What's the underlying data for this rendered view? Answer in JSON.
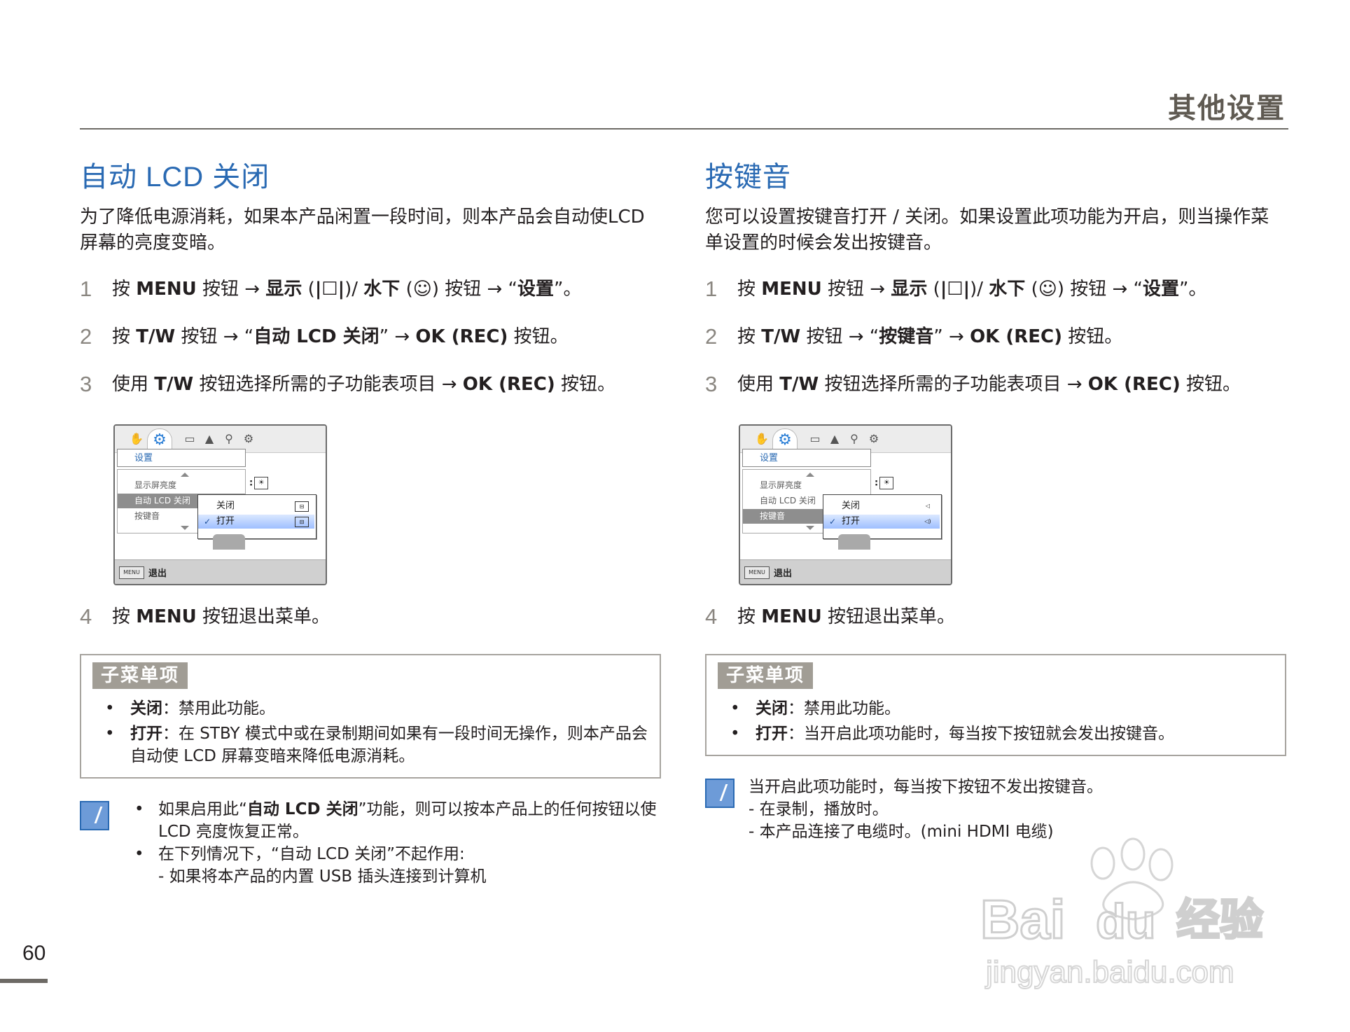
{
  "header": {
    "title": "其他设置"
  },
  "page_number": "60",
  "left": {
    "title": "自动 LCD 关闭",
    "intro": "为了降低电源消耗，如果本产品闲置一段时间，则本产品会自动使LCD 屏幕的亮度变暗。",
    "steps": [
      {
        "num": "1",
        "t1": "按 ",
        "b1": "MENU",
        "t2": " 按钮  → ",
        "b2": "显示",
        "t3": " (",
        "b3": "|☐|",
        "t4": ")/ ",
        "b4": "水下",
        "t5": " (☺) 按钮  → “",
        "b5": "设置",
        "t6": "”。"
      },
      {
        "num": "2",
        "t1": "按 ",
        "b1": "T/W",
        "t2": " 按钮  → “",
        "b2": "自动 LCD 关闭",
        "t3": "” → ",
        "b3": "OK (REC)",
        "t4": " 按钮。"
      },
      {
        "num": "3",
        "t1": "使用 ",
        "b1": "T/W",
        "t2": " 按钮选择所需的子功能表项目 → ",
        "b2": "OK (REC)",
        "t3": " 按钮。"
      },
      {
        "num": "4",
        "t1": "按 ",
        "b1": "MENU",
        "t2": " 按钮退出菜单。"
      }
    ],
    "menu": {
      "category": "设置",
      "items": [
        "显示屏亮度",
        "自动 LCD 关闭",
        "按键音"
      ],
      "highlight_index": 1,
      "current_value_prefix": ":",
      "current_value_icon": "☀",
      "options": [
        "关闭",
        "打开"
      ],
      "option_icons": [
        "⊟",
        "⊟"
      ],
      "selected_index": 1,
      "check_glyph": "✓",
      "menu_button": "MENU",
      "exit": "退出"
    },
    "submenu": {
      "tag": "子菜单项",
      "items": [
        {
          "key": "关闭",
          "sep": "：",
          "desc": "禁用此功能。"
        },
        {
          "key": "打开",
          "sep": "：",
          "desc": "在 STBY 模式中或在录制期间如果有一段时间无操作，则本产品会自动使 LCD 屏幕变暗来降低电源消耗。"
        }
      ]
    },
    "note": {
      "b1_t1": "如果启用此“",
      "b1_b": "自动 LCD 关闭",
      "b1_t2": "”功能，则可以按本产品上的任何按钮以使 LCD 亮度恢复正常。",
      "b2": "在下列情况下，“自动 LCD 关闭”不起作用:",
      "sub1": "- 如果将本产品的内置 USB 插头连接到计算机"
    }
  },
  "right": {
    "title": "按键音",
    "intro": "您可以设置按键音打开 / 关闭。如果设置此项功能为开启，则当操作菜单设置的时候会发出按键音。",
    "steps": [
      {
        "num": "1",
        "t1": "按 ",
        "b1": "MENU",
        "t2": " 按钮  → ",
        "b2": "显示",
        "t3": " (",
        "b3": "|☐|",
        "t4": ")/ ",
        "b4": "水下",
        "t5": " (☺) 按钮  → “",
        "b5": "设置",
        "t6": "”。"
      },
      {
        "num": "2",
        "t1": "按 ",
        "b1": "T/W",
        "t2": " 按钮  → “",
        "b2": "按键音",
        "t3": "” → ",
        "b3": "OK (REC)",
        "t4": " 按钮。"
      },
      {
        "num": "3",
        "t1": "使用 ",
        "b1": "T/W",
        "t2": " 按钮选择所需的子功能表项目 → ",
        "b2": "OK (REC)",
        "t3": " 按钮。"
      },
      {
        "num": "4",
        "t1": "按 ",
        "b1": "MENU",
        "t2": " 按钮退出菜单。"
      }
    ],
    "menu": {
      "category": "设置",
      "items": [
        "显示屏亮度",
        "自动 LCD 关闭",
        "按键音"
      ],
      "highlight_index": 2,
      "current_value_prefix": ":",
      "current_value_icon": "☀",
      "options": [
        "关闭",
        "打开"
      ],
      "option_icons": [
        "◁",
        "◁)"
      ],
      "selected_index": 1,
      "check_glyph": "✓",
      "menu_button": "MENU",
      "exit": "退出"
    },
    "submenu": {
      "tag": "子菜单项",
      "items": [
        {
          "key": "关闭",
          "sep": "：",
          "desc": "禁用此功能。"
        },
        {
          "key": "打开",
          "sep": "：",
          "desc": "当开启此项功能时，每当按下按钮就会发出按键音。"
        }
      ]
    },
    "note": {
      "line1": "当开启此项功能时，每当按下按钮不发出按键音。",
      "sub1": "- 在录制，播放时。",
      "sub2": "- 本产品连接了电缆时。(mini HDMI 电缆)"
    }
  },
  "watermark": {
    "brand": "Baidu经验",
    "url": "jingyan.baidu.com"
  }
}
